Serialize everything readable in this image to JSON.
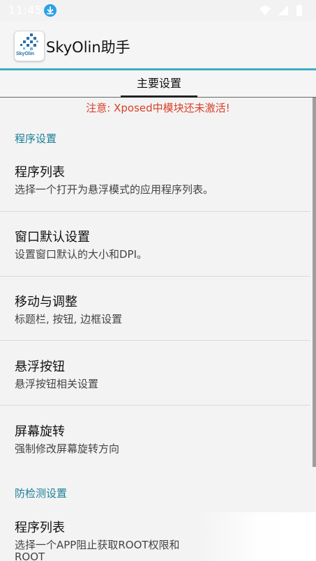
{
  "status": {
    "time": "11:45"
  },
  "app": {
    "title": "SkyOlin助手",
    "logo_text": "SkyOlin"
  },
  "tabs": [
    {
      "label": "主要设置"
    }
  ],
  "warning": "注意: Xposed中模块还未激活!",
  "sections": [
    {
      "title": "程序设置",
      "items": [
        {
          "title": "程序列表",
          "subtitle": "选择一个打开为悬浮模式的应用程序列表。"
        },
        {
          "title": "窗口默认设置",
          "subtitle": "设置窗口默认的大小和DPI。"
        },
        {
          "title": "移动与调整",
          "subtitle": "标题栏, 按钮, 边框设置"
        },
        {
          "title": "悬浮按钮",
          "subtitle": "悬浮按钮相关设置"
        },
        {
          "title": "屏幕旋转",
          "subtitle": "强制修改屏幕旋转方向"
        }
      ]
    },
    {
      "title": "防检测设置",
      "items": [
        {
          "title": "程序列表",
          "subtitle": "选择一个APP阻止获取ROOT权限和",
          "subtitle2": "ROOT"
        }
      ]
    }
  ],
  "colors": {
    "accent": "#3aaec4",
    "section": "#1a7f96",
    "warning": "#d83f26"
  }
}
